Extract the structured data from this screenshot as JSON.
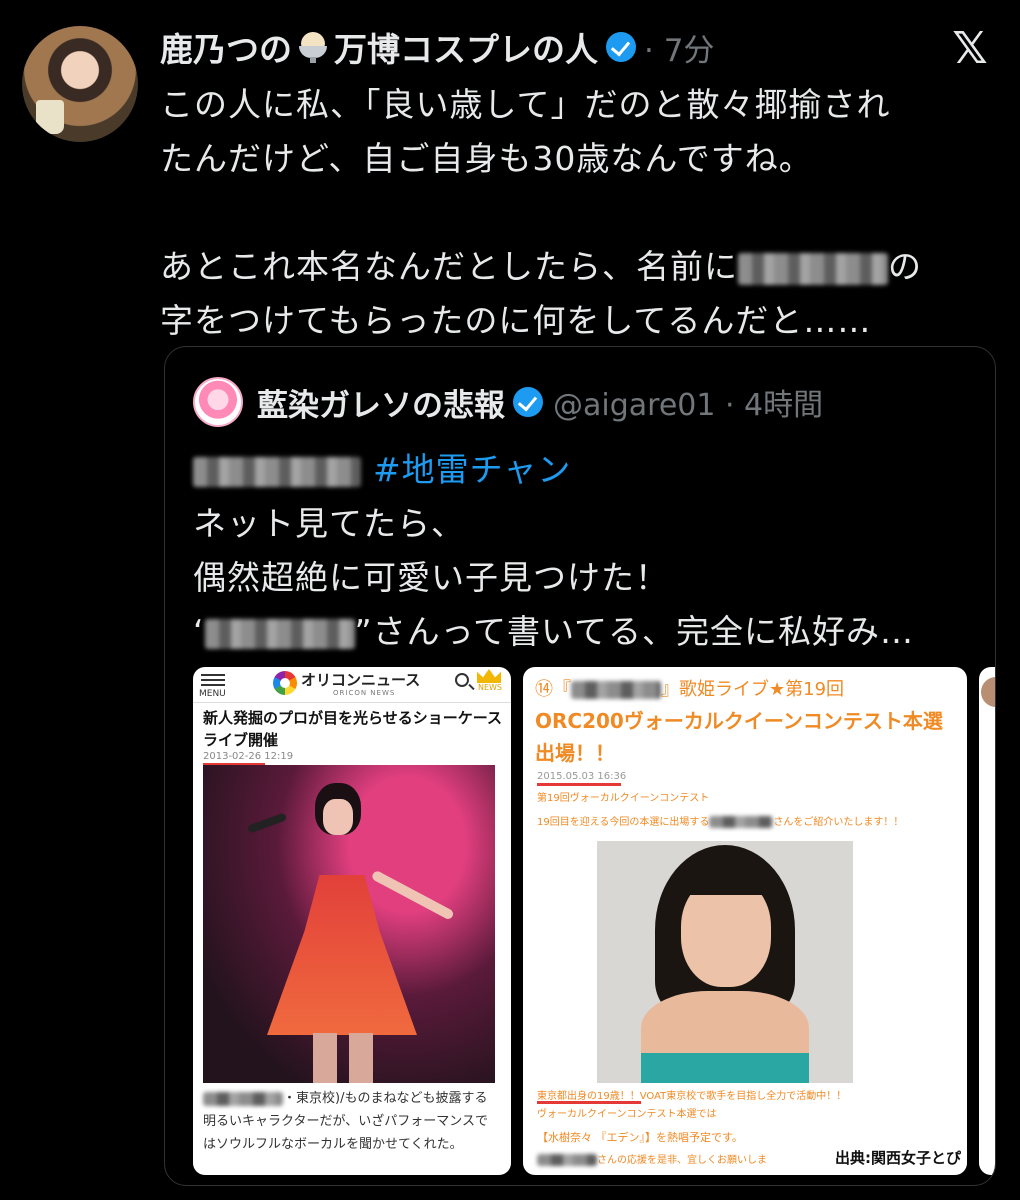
{
  "tweet": {
    "author_name_part1": "鹿乃つの",
    "author_name_part2": "万博コスプレの人",
    "time": "· 7分",
    "lines": [
      "この人に私、「良い歳して」だのと散々揶揄され",
      "たんだけど、自ご自身も30歳なんですね。",
      "",
      "あとこれ本名なんだとしたら、名前に",
      "の",
      "字をつけてもらったのに何をしてるんだと……"
    ]
  },
  "quote": {
    "author_name": "藍染ガレソの悲報",
    "handle_time": "@aigare01 · 4時間",
    "hashtag": "#地雷チャン",
    "lines": [
      "ネット見てたら、",
      "偶然超絶に可愛い子見つけた！",
      "‘",
      "”さんって書いてる、完全に私好み…"
    ]
  },
  "oricon": {
    "menu_label": "MENU",
    "brand": "オリコンニュース",
    "brand_sub": "ORICON NEWS",
    "news_label": "NEWS",
    "headline": "新人発掘のプロが目を光らせるショーケースライブ開催",
    "date": "2013-02-26 12:19",
    "caption_line1": "・東京校)/ものまねなども披露する",
    "caption_line2": "明るいキャラクターだが、いざパフォーマンスで",
    "caption_line3": "はソウルフルなボーカルを聞かせてくれた。"
  },
  "orc": {
    "title_prefix": "⑭『",
    "title_suffix": "』歌姫ライブ★第19回",
    "title_main": "ORC200ヴォーカルクイーンコンテスト本選出場！！",
    "date": "2015.05.03 16:36",
    "subheading": "第19回ヴォーカルクイーンコンテスト",
    "intro_prefix": "19回目を迎える今回の本選に出場する",
    "intro_suffix": "さんをご紹介いたします！！",
    "foot1": "東京都出身の19歳！！VOAT東京校で歌手を目指し全力で活動中！！",
    "foot2": "ヴォーカルクイーンコンテスト本選では",
    "foot3": "【水樹奈々 『エデン』】を熱唱予定です。",
    "foot4": "さんの応援を是非、宜しくお願いしま",
    "source": "出典:関西女子とぴ"
  },
  "colors": {
    "background": "#000000",
    "text": "#e7e9ea",
    "muted": "#71767b",
    "link": "#1d9bf0",
    "accent_orange": "#f08a24"
  },
  "icons": {
    "verified": "verified-badge-icon",
    "close": "x-logo-icon",
    "search": "search-icon",
    "menu": "hamburger-menu-icon",
    "crown": "crown-icon"
  }
}
